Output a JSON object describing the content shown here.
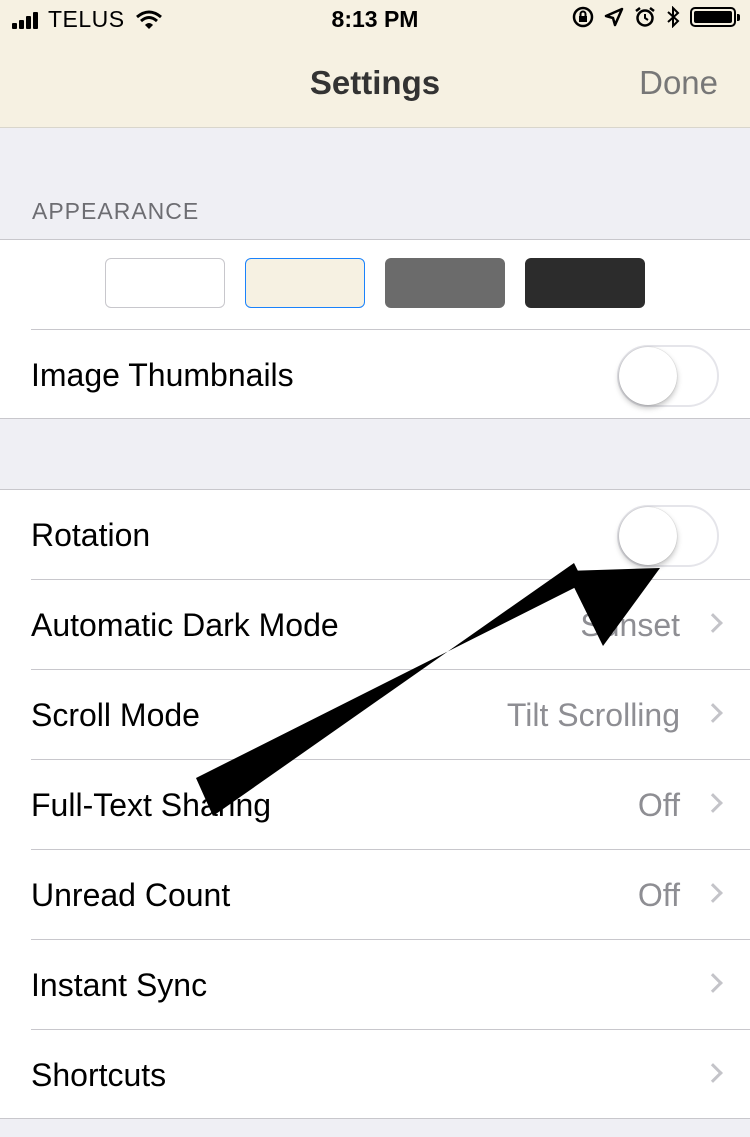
{
  "status_bar": {
    "carrier": "TELUS",
    "time": "8:13 PM",
    "icons": [
      "signal-icon",
      "wifi-icon",
      "rotation-lock-icon",
      "location-icon",
      "alarm-icon",
      "bluetooth-icon",
      "battery-icon"
    ]
  },
  "nav": {
    "title": "Settings",
    "done_label": "Done",
    "background": "#f6f1e2"
  },
  "appearance": {
    "header": "APPEARANCE",
    "themes": [
      {
        "name": "white",
        "color": "#ffffff",
        "selected": false
      },
      {
        "name": "sepia",
        "color": "#f6f1e2",
        "selected": true
      },
      {
        "name": "gray",
        "color": "#6b6b6b",
        "selected": false
      },
      {
        "name": "dark",
        "color": "#2c2c2c",
        "selected": false
      }
    ],
    "image_thumbnails": {
      "label": "Image Thumbnails",
      "on": false
    }
  },
  "settings": {
    "rotation": {
      "label": "Rotation",
      "on": false
    },
    "automatic_dark_mode": {
      "label": "Automatic Dark Mode",
      "value": "Sunset"
    },
    "scroll_mode": {
      "label": "Scroll Mode",
      "value": "Tilt Scrolling"
    },
    "full_text_sharing": {
      "label": "Full-Text Sharing",
      "value": "Off"
    },
    "unread_count": {
      "label": "Unread Count",
      "value": "Off"
    },
    "instant_sync": {
      "label": "Instant Sync"
    },
    "shortcuts": {
      "label": "Shortcuts"
    }
  },
  "colors": {
    "accent": "#1a82fb",
    "annotation_arrow": "#000000"
  }
}
